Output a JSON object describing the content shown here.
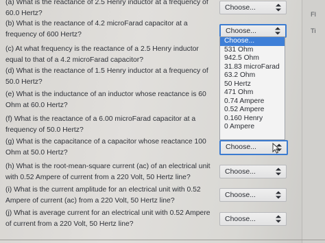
{
  "questions": [
    {
      "text": "(a) What is the reactance of 2.5 Henry inductor at a frequency of 60.0 Hertz?",
      "select": "Choose..."
    },
    {
      "text": "(b) What is the reactance of 4.2 microFarad capacitor at a frequency of 600 Hertz?",
      "select": "Choose..."
    },
    {
      "text": "(c) At what frequency is the reactance of a 2.5 Henry inductor equal to that of a 4.2 microFarad capacitor?",
      "select": ""
    },
    {
      "text": "(d) What is the reactance of 1.5 Henry inductor at a frequency of 50.0 Hertz?",
      "select": ""
    },
    {
      "text": "(e) What is the inductance of an inductor whose reactance is 60 Ohm at 60.0 Hertz?",
      "select": ""
    },
    {
      "text": "(f) What is the reactance of a 6.00 microFarad capacitor at a frequency of 50.0 Hertz?",
      "select": ""
    },
    {
      "text": "(g) What is the capacitance of a capacitor whose reactance 100 Ohm at 50.0 Hertz?",
      "select": "Choose..."
    },
    {
      "text": "(h) What is the root-mean-square current (ac) of an electrical unit with 0.52 Ampere of current from a 220 Volt, 50 Hertz line?",
      "select": "Choose..."
    },
    {
      "text": "(i) What is the current amplitude for an electrical unit with 0.52 Ampere of current (ac) from a 220 Volt, 50 Hertz line?",
      "select": "Choose..."
    },
    {
      "text": "(j) What is average current for an electrical unit with 0.52 Ampere of current from a 220 Volt, 50 Hertz line?",
      "select": "Choose..."
    }
  ],
  "dropdown": {
    "options": [
      "Choose...",
      "531 Ohm",
      "942.5 Ohm",
      "31.83 microFarad",
      "63.2 Ohm",
      "50 Hertz",
      "471 Ohm",
      "0.74 Ampere",
      "0.52 Ampere",
      "0.160 Henry",
      "0 Ampere"
    ]
  },
  "right_panel": {
    "label_1": "Fl",
    "label_2": "Ti"
  },
  "colors": {
    "highlight": "#3e7fd7",
    "focus_border": "#3b7bd0"
  }
}
